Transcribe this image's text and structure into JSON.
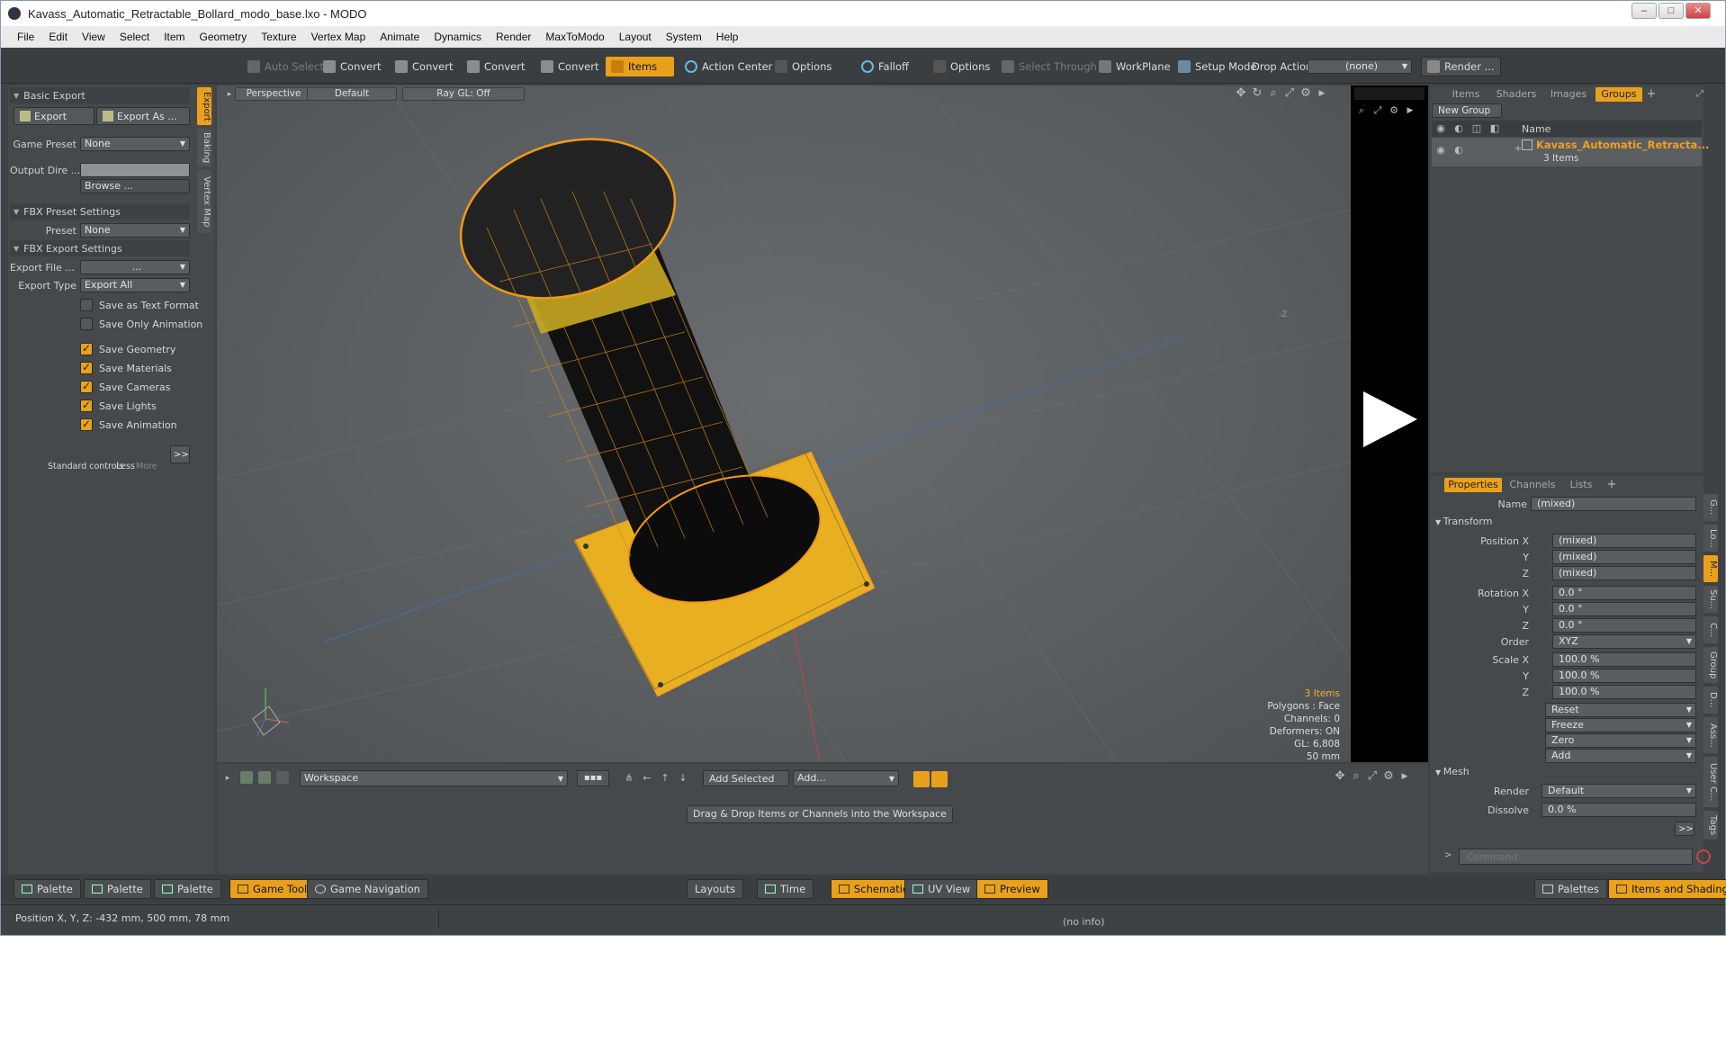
{
  "window": {
    "title": "Kavass_Automatic_Retractable_Bollard_modo_base.lxo - MODO"
  },
  "menu": [
    "File",
    "Edit",
    "View",
    "Select",
    "Item",
    "Geometry",
    "Texture",
    "Vertex Map",
    "Animate",
    "Dynamics",
    "Render",
    "MaxToModo",
    "Layout",
    "System",
    "Help"
  ],
  "toolbar": {
    "auto_select": "Auto Select",
    "convert": "Convert",
    "items": "Items",
    "action_center": "Action Center",
    "options": "Options",
    "falloff": "Falloff",
    "select_through": "Select Through",
    "workplane": "WorkPlane",
    "setup_mode": "Setup Mode",
    "drop_action": "Drop Action",
    "drop_value": "(none)",
    "render": "Render ..."
  },
  "left_panel": {
    "basic_export": "Basic Export",
    "export": "Export",
    "export_as": "Export As ...",
    "game_preset_label": "Game Preset",
    "game_preset_value": "None",
    "output_dir_label": "Output Dire ...",
    "browse": "Browse ...",
    "fbx_preset_settings": "FBX Preset Settings",
    "preset_label": "Preset",
    "preset_value": "None",
    "fbx_export_settings": "FBX Export Settings",
    "export_file_label": "Export File ...",
    "export_file_value": "...",
    "export_type_label": "Export Type",
    "export_type_value": "Export All",
    "save_text": "Save as Text Format",
    "save_only_anim": "Save Only Animation",
    "save_geometry": "Save Geometry",
    "save_materials": "Save Materials",
    "save_cameras": "Save Cameras",
    "save_lights": "Save Lights",
    "save_animation": "Save Animation",
    "expand": ">>",
    "standard_controls": "Standard controls",
    "less": "Less",
    "more": "More",
    "vtabs": [
      "Export",
      "Baking",
      "Vertex Map"
    ]
  },
  "viewport": {
    "perspective": "Perspective",
    "default": "Default",
    "raygl": "Ray GL: Off",
    "info": [
      "3 Items",
      "Polygons : Face",
      "Channels: 0",
      "Deformers: ON",
      "GL: 6,808",
      "50 mm"
    ],
    "z_marker": "-Z"
  },
  "workspace": {
    "workspace_value": "Workspace",
    "add_selected": "Add Selected",
    "add": "Add...",
    "drag_hint": "Drag & Drop Items or Channels into the Workspace"
  },
  "right_panel": {
    "tabs": [
      "Items",
      "Shaders",
      "Images",
      "Groups"
    ],
    "new_group": "New Group",
    "name_col": "Name",
    "group_name": "Kavass_Automatic_Retracta...",
    "group_count": "3 Items",
    "prop_tabs": [
      "Properties",
      "Channels",
      "Lists"
    ],
    "name_label": "Name",
    "name_value": "(mixed)",
    "transform": "Transform",
    "position_label": "Position X",
    "rotation_label": "Rotation X",
    "scale_label": "Scale X",
    "y_label": "Y",
    "z_label": "Z",
    "order_label": "Order",
    "pos": [
      "(mixed)",
      "(mixed)",
      "(mixed)"
    ],
    "rot": [
      "0.0 °",
      "0.0 °",
      "0.0 °"
    ],
    "order_value": "XYZ",
    "scale": [
      "100.0 %",
      "100.0 %",
      "100.0 %"
    ],
    "actions": [
      "Reset",
      "Freeze",
      "Zero",
      "Add"
    ],
    "mesh": "Mesh",
    "render_label": "Render",
    "render_value": "Default",
    "dissolve_label": "Dissolve",
    "dissolve_value": "0.0 %",
    "expand": ">>",
    "command_placeholder": "Command",
    "side_tabs": [
      "G...",
      "Lo...",
      "M...",
      "Su...",
      "C...",
      "Group",
      "D...",
      "Ass...",
      "User C...",
      "Tags"
    ]
  },
  "bottom_bar": {
    "palette": "Palette",
    "game_tools": "Game Tools",
    "game_navigation": "Game Navigation",
    "layouts": "Layouts",
    "time": "Time",
    "schematic": "Schematic",
    "uv_view": "UV View",
    "preview": "Preview",
    "palettes": "Palettes",
    "items_shading": "Items and Shading"
  },
  "status": {
    "position": "Position X, Y, Z:  -432 mm, 500 mm, 78 mm",
    "info": "(no info)"
  }
}
